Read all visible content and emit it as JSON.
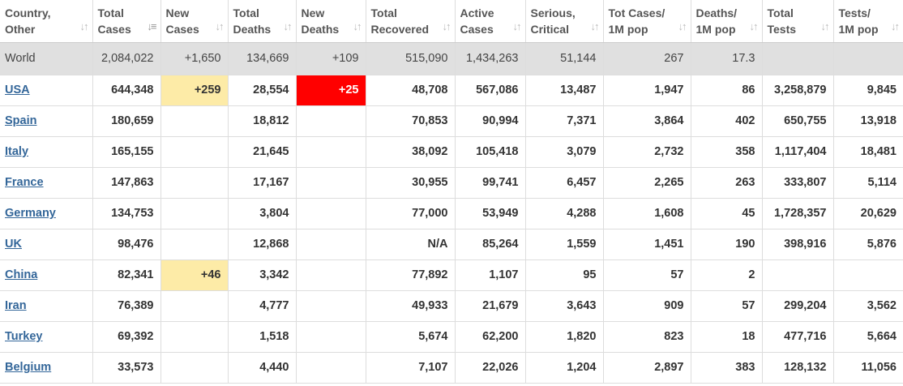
{
  "columns": [
    {
      "line1": "Country,",
      "line2": "Other",
      "sort": "updown",
      "sort_active": false
    },
    {
      "line1": "Total",
      "line2": "Cases",
      "sort": "active",
      "sort_active": true
    },
    {
      "line1": "New",
      "line2": "Cases",
      "sort": "updown",
      "sort_active": false
    },
    {
      "line1": "Total",
      "line2": "Deaths",
      "sort": "updown",
      "sort_active": false
    },
    {
      "line1": "New",
      "line2": "Deaths",
      "sort": "updown",
      "sort_active": false
    },
    {
      "line1": "Total",
      "line2": "Recovered",
      "sort": "updown",
      "sort_active": false
    },
    {
      "line1": "Active",
      "line2": "Cases",
      "sort": "updown",
      "sort_active": false
    },
    {
      "line1": "Serious,",
      "line2": "Critical",
      "sort": "updown",
      "sort_active": false
    },
    {
      "line1": "Tot Cases/",
      "line2": "1M pop",
      "sort": "updown",
      "sort_active": false
    },
    {
      "line1": "Deaths/",
      "line2": "1M pop",
      "sort": "updown",
      "sort_active": false
    },
    {
      "line1": "Total",
      "line2": "Tests",
      "sort": "updown",
      "sort_active": false
    },
    {
      "line1": "Tests/",
      "line2": "1M pop",
      "sort": "updown",
      "sort_active": false
    }
  ],
  "icons": {
    "sort_updown": "↓↑",
    "sort_active": "↓≡"
  },
  "colors": {
    "world_row_bg": "#e0e0e0",
    "new_cases_highlight": "#fdeba7",
    "new_deaths_highlight": "#ff0000",
    "country_link": "#336699"
  },
  "world": {
    "country": "World",
    "total_cases": "2,084,022",
    "new_cases": "+1,650",
    "total_deaths": "134,669",
    "new_deaths": "+109",
    "total_recovered": "515,090",
    "active_cases": "1,434,263",
    "serious_critical": "51,144",
    "cases_per_1m": "267",
    "deaths_per_1m": "17.3",
    "total_tests": "",
    "tests_per_1m": ""
  },
  "rows": [
    {
      "country": "USA",
      "total_cases": "644,348",
      "new_cases": "+259",
      "total_deaths": "28,554",
      "new_deaths": "+25",
      "total_recovered": "48,708",
      "active_cases": "567,086",
      "serious_critical": "13,487",
      "cases_per_1m": "1,947",
      "deaths_per_1m": "86",
      "total_tests": "3,258,879",
      "tests_per_1m": "9,845"
    },
    {
      "country": "Spain",
      "total_cases": "180,659",
      "new_cases": "",
      "total_deaths": "18,812",
      "new_deaths": "",
      "total_recovered": "70,853",
      "active_cases": "90,994",
      "serious_critical": "7,371",
      "cases_per_1m": "3,864",
      "deaths_per_1m": "402",
      "total_tests": "650,755",
      "tests_per_1m": "13,918"
    },
    {
      "country": "Italy",
      "total_cases": "165,155",
      "new_cases": "",
      "total_deaths": "21,645",
      "new_deaths": "",
      "total_recovered": "38,092",
      "active_cases": "105,418",
      "serious_critical": "3,079",
      "cases_per_1m": "2,732",
      "deaths_per_1m": "358",
      "total_tests": "1,117,404",
      "tests_per_1m": "18,481"
    },
    {
      "country": "France",
      "total_cases": "147,863",
      "new_cases": "",
      "total_deaths": "17,167",
      "new_deaths": "",
      "total_recovered": "30,955",
      "active_cases": "99,741",
      "serious_critical": "6,457",
      "cases_per_1m": "2,265",
      "deaths_per_1m": "263",
      "total_tests": "333,807",
      "tests_per_1m": "5,114"
    },
    {
      "country": "Germany",
      "total_cases": "134,753",
      "new_cases": "",
      "total_deaths": "3,804",
      "new_deaths": "",
      "total_recovered": "77,000",
      "active_cases": "53,949",
      "serious_critical": "4,288",
      "cases_per_1m": "1,608",
      "deaths_per_1m": "45",
      "total_tests": "1,728,357",
      "tests_per_1m": "20,629"
    },
    {
      "country": "UK",
      "total_cases": "98,476",
      "new_cases": "",
      "total_deaths": "12,868",
      "new_deaths": "",
      "total_recovered": "N/A",
      "active_cases": "85,264",
      "serious_critical": "1,559",
      "cases_per_1m": "1,451",
      "deaths_per_1m": "190",
      "total_tests": "398,916",
      "tests_per_1m": "5,876"
    },
    {
      "country": "China",
      "total_cases": "82,341",
      "new_cases": "+46",
      "total_deaths": "3,342",
      "new_deaths": "",
      "total_recovered": "77,892",
      "active_cases": "1,107",
      "serious_critical": "95",
      "cases_per_1m": "57",
      "deaths_per_1m": "2",
      "total_tests": "",
      "tests_per_1m": ""
    },
    {
      "country": "Iran",
      "total_cases": "76,389",
      "new_cases": "",
      "total_deaths": "4,777",
      "new_deaths": "",
      "total_recovered": "49,933",
      "active_cases": "21,679",
      "serious_critical": "3,643",
      "cases_per_1m": "909",
      "deaths_per_1m": "57",
      "total_tests": "299,204",
      "tests_per_1m": "3,562"
    },
    {
      "country": "Turkey",
      "total_cases": "69,392",
      "new_cases": "",
      "total_deaths": "1,518",
      "new_deaths": "",
      "total_recovered": "5,674",
      "active_cases": "62,200",
      "serious_critical": "1,820",
      "cases_per_1m": "823",
      "deaths_per_1m": "18",
      "total_tests": "477,716",
      "tests_per_1m": "5,664"
    },
    {
      "country": "Belgium",
      "total_cases": "33,573",
      "new_cases": "",
      "total_deaths": "4,440",
      "new_deaths": "",
      "total_recovered": "7,107",
      "active_cases": "22,026",
      "serious_critical": "1,204",
      "cases_per_1m": "2,897",
      "deaths_per_1m": "383",
      "total_tests": "128,132",
      "tests_per_1m": "11,056"
    }
  ]
}
